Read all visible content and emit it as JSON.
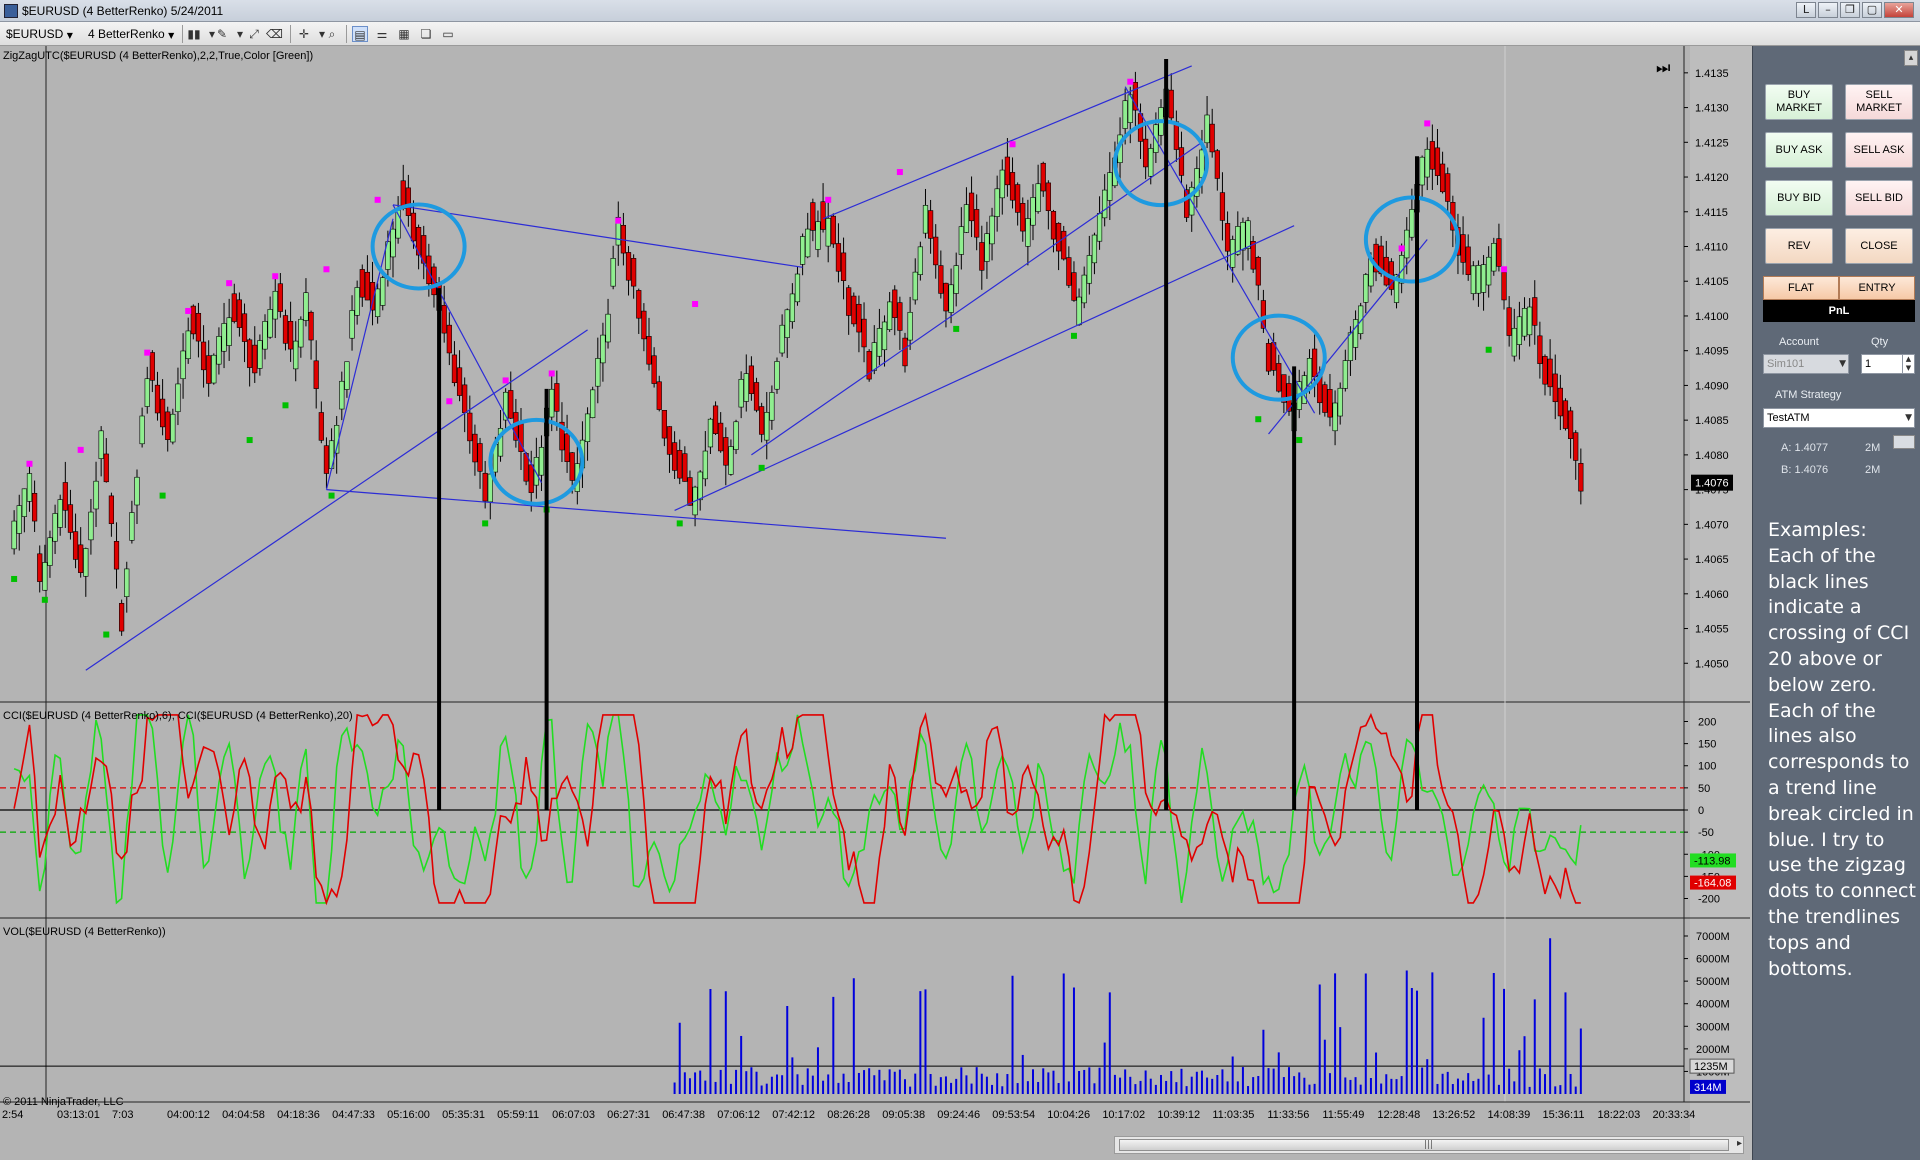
{
  "window": {
    "title": "$EURUSD (4 BetterRenko)  5/24/2011",
    "controls": [
      "L",
      "–",
      "❐",
      "▢",
      "✕"
    ]
  },
  "toolbar": {
    "instrument": "$EURUSD",
    "period": "4 BetterRenko"
  },
  "chart_data": [
    {
      "type": "candlestick",
      "panel_label": "ZigZagUTC($EURUSD (4 BetterRenko),2,2,True,Color [Green])",
      "y_ticks": [
        "1.4135",
        "1.4130",
        "1.4125",
        "1.4120",
        "1.4115",
        "1.4110",
        "1.4105",
        "1.4100",
        "1.4095",
        "1.4090",
        "1.4085",
        "1.4080",
        "1.4075",
        "1.4070",
        "1.4065",
        "1.4060",
        "1.4055",
        "1.4050"
      ],
      "ylim": [
        1.4045,
        1.4138
      ],
      "last_price": "1.4076",
      "up_color": "#90ee90",
      "down_color": "#e00000",
      "zigzag_dot_high_color": "#ff00ff",
      "zigzag_dot_low_color": "#00c000",
      "price_path": [
        {
          "b": 0,
          "v": 1.4067
        },
        {
          "b": 4,
          "v": 1.4078
        },
        {
          "b": 6,
          "v": 1.4061
        },
        {
          "b": 10,
          "v": 1.4075
        },
        {
          "b": 14,
          "v": 1.4062
        },
        {
          "b": 18,
          "v": 1.4082
        },
        {
          "b": 22,
          "v": 1.4056
        },
        {
          "b": 27,
          "v": 1.4092
        },
        {
          "b": 31,
          "v": 1.4082
        },
        {
          "b": 35,
          "v": 1.4099
        },
        {
          "b": 39,
          "v": 1.4091
        },
        {
          "b": 43,
          "v": 1.4101
        },
        {
          "b": 48,
          "v": 1.4092
        },
        {
          "b": 52,
          "v": 1.4104
        },
        {
          "b": 55,
          "v": 1.4094
        },
        {
          "b": 58,
          "v": 1.4103
        },
        {
          "b": 62,
          "v": 1.4076
        },
        {
          "b": 68,
          "v": 1.4104
        },
        {
          "b": 71,
          "v": 1.4101
        },
        {
          "b": 76,
          "v": 1.4116
        },
        {
          "b": 80,
          "v": 1.411
        },
        {
          "b": 84,
          "v": 1.41
        },
        {
          "b": 90,
          "v": 1.4083
        },
        {
          "b": 93,
          "v": 1.4073
        },
        {
          "b": 97,
          "v": 1.4088
        },
        {
          "b": 102,
          "v": 1.4075
        },
        {
          "b": 106,
          "v": 1.4089
        },
        {
          "b": 110,
          "v": 1.4075
        },
        {
          "b": 116,
          "v": 1.4096
        },
        {
          "b": 119,
          "v": 1.4113
        },
        {
          "b": 124,
          "v": 1.4096
        },
        {
          "b": 128,
          "v": 1.4083
        },
        {
          "b": 133,
          "v": 1.4073
        },
        {
          "b": 137,
          "v": 1.4085
        },
        {
          "b": 140,
          "v": 1.4079
        },
        {
          "b": 144,
          "v": 1.4093
        },
        {
          "b": 147,
          "v": 1.4083
        },
        {
          "b": 152,
          "v": 1.4101
        },
        {
          "b": 156,
          "v": 1.4113
        },
        {
          "b": 160,
          "v": 1.4114
        },
        {
          "b": 164,
          "v": 1.4101
        },
        {
          "b": 168,
          "v": 1.4092
        },
        {
          "b": 172,
          "v": 1.4103
        },
        {
          "b": 175,
          "v": 1.4094
        },
        {
          "b": 179,
          "v": 1.4116
        },
        {
          "b": 183,
          "v": 1.41
        },
        {
          "b": 187,
          "v": 1.4116
        },
        {
          "b": 190,
          "v": 1.4108
        },
        {
          "b": 194,
          "v": 1.412
        },
        {
          "b": 198,
          "v": 1.4112
        },
        {
          "b": 201,
          "v": 1.4119
        },
        {
          "b": 205,
          "v": 1.411
        },
        {
          "b": 208,
          "v": 1.4101
        },
        {
          "b": 212,
          "v": 1.4113
        },
        {
          "b": 216,
          "v": 1.4123
        },
        {
          "b": 219,
          "v": 1.4133
        },
        {
          "b": 222,
          "v": 1.412
        },
        {
          "b": 226,
          "v": 1.4133
        },
        {
          "b": 230,
          "v": 1.4115
        },
        {
          "b": 234,
          "v": 1.4128
        },
        {
          "b": 238,
          "v": 1.411
        },
        {
          "b": 242,
          "v": 1.4113
        },
        {
          "b": 246,
          "v": 1.4093
        },
        {
          "b": 250,
          "v": 1.4087
        },
        {
          "b": 254,
          "v": 1.4094
        },
        {
          "b": 258,
          "v": 1.4084
        },
        {
          "b": 262,
          "v": 1.4097
        },
        {
          "b": 266,
          "v": 1.4108
        },
        {
          "b": 270,
          "v": 1.4104
        },
        {
          "b": 274,
          "v": 1.4116
        },
        {
          "b": 277,
          "v": 1.4125
        },
        {
          "b": 281,
          "v": 1.4115
        },
        {
          "b": 285,
          "v": 1.4105
        },
        {
          "b": 290,
          "v": 1.411
        },
        {
          "b": 293,
          "v": 1.4098
        },
        {
          "b": 297,
          "v": 1.4102
        },
        {
          "b": 300,
          "v": 1.409
        },
        {
          "b": 304,
          "v": 1.4084
        },
        {
          "b": 307,
          "v": 1.4076
        }
      ],
      "zigzag_highs": [
        {
          "b": 4,
          "v": 1.4078
        },
        {
          "b": 14,
          "v": 1.408
        },
        {
          "b": 27,
          "v": 1.4094
        },
        {
          "b": 35,
          "v": 1.41
        },
        {
          "b": 43,
          "v": 1.4104
        },
        {
          "b": 52,
          "v": 1.4105
        },
        {
          "b": 62,
          "v": 1.4106
        },
        {
          "b": 72,
          "v": 1.4116
        },
        {
          "b": 86,
          "v": 1.4087
        },
        {
          "b": 97,
          "v": 1.409
        },
        {
          "b": 106,
          "v": 1.4091
        },
        {
          "b": 119,
          "v": 1.4113
        },
        {
          "b": 134,
          "v": 1.4101
        },
        {
          "b": 160,
          "v": 1.4116
        },
        {
          "b": 174,
          "v": 1.412
        },
        {
          "b": 196,
          "v": 1.4124
        },
        {
          "b": 219,
          "v": 1.4133
        },
        {
          "b": 272,
          "v": 1.4109
        },
        {
          "b": 277,
          "v": 1.4127
        },
        {
          "b": 292,
          "v": 1.4106
        }
      ],
      "zigzag_lows": [
        {
          "b": 1,
          "v": 1.4063
        },
        {
          "b": 7,
          "v": 1.406
        },
        {
          "b": 19,
          "v": 1.4055
        },
        {
          "b": 30,
          "v": 1.4075
        },
        {
          "b": 47,
          "v": 1.4083
        },
        {
          "b": 54,
          "v": 1.4088
        },
        {
          "b": 63,
          "v": 1.4075
        },
        {
          "b": 93,
          "v": 1.4071
        },
        {
          "b": 105,
          "v": 1.4073
        },
        {
          "b": 131,
          "v": 1.4071
        },
        {
          "b": 147,
          "v": 1.4079
        },
        {
          "b": 185,
          "v": 1.4099
        },
        {
          "b": 208,
          "v": 1.4098
        },
        {
          "b": 244,
          "v": 1.4086
        },
        {
          "b": 252,
          "v": 1.4083
        },
        {
          "b": 289,
          "v": 1.4096
        }
      ],
      "trendlines": [
        {
          "from": {
            "b": 15,
            "v": 1.4049
          },
          "to": {
            "b": 113,
            "v": 1.4098
          }
        },
        {
          "from": {
            "b": 62,
            "v": 1.4075
          },
          "to": {
            "b": 183,
            "v": 1.4068
          }
        },
        {
          "from": {
            "b": 62,
            "v": 1.4075
          },
          "to": {
            "b": 75,
            "v": 1.4114
          }
        },
        {
          "from": {
            "b": 75,
            "v": 1.4116
          },
          "to": {
            "b": 155,
            "v": 1.4107
          }
        },
        {
          "from": {
            "b": 75,
            "v": 1.4116
          },
          "to": {
            "b": 104,
            "v": 1.4076
          }
        },
        {
          "from": {
            "b": 130,
            "v": 1.4072
          },
          "to": {
            "b": 251,
            "v": 1.4113
          }
        },
        {
          "from": {
            "b": 145,
            "v": 1.408
          },
          "to": {
            "b": 233,
            "v": 1.4125
          }
        },
        {
          "from": {
            "b": 159,
            "v": 1.4114
          },
          "to": {
            "b": 231,
            "v": 1.4136
          }
        },
        {
          "from": {
            "b": 218,
            "v": 1.4133
          },
          "to": {
            "b": 255,
            "v": 1.4086
          }
        },
        {
          "from": {
            "b": 246,
            "v": 1.4083
          },
          "to": {
            "b": 277,
            "v": 1.4111
          }
        }
      ],
      "circles": [
        {
          "b": 80,
          "v": 1.411
        },
        {
          "b": 103,
          "v": 1.4079
        },
        {
          "b": 225,
          "v": 1.4122
        },
        {
          "b": 248,
          "v": 1.4094
        },
        {
          "b": 274,
          "v": 1.4111
        }
      ],
      "signal_lines_bars": [
        84,
        105,
        226,
        251,
        275
      ]
    },
    {
      "type": "line",
      "panel_label": "CCI($EURUSD (4 BetterRenko),6), CCI($EURUSD (4 BetterRenko),20)",
      "y_ticks": [
        "200",
        "150",
        "100",
        "50",
        "0",
        "-50",
        "-100",
        "-150",
        "-200"
      ],
      "ylim": [
        -235,
        235
      ],
      "reference_lines": [
        {
          "v": 50,
          "color": "#e00000"
        },
        {
          "v": -50,
          "color": "#00aa00"
        },
        {
          "v": 0,
          "color": "#000000"
        }
      ],
      "last_values": {
        "cci6": "-113.98",
        "cci20": "-164.08"
      },
      "series": [
        {
          "name": "CCI 6",
          "color": "#22dd22"
        },
        {
          "name": "CCI 20",
          "color": "#e00000"
        }
      ]
    },
    {
      "type": "bar",
      "panel_label": "VOL($EURUSD (4 BetterRenko))",
      "y_ticks": [
        "7000M",
        "6000M",
        "5000M",
        "4000M",
        "3000M",
        "2000M",
        "1000M"
      ],
      "ylim": [
        0,
        7000
      ],
      "marker_line": "1235M",
      "last_value": "314M",
      "color": "#0000dd"
    }
  ],
  "time_axis": [
    "2:54",
    "03:13:01",
    "7:03",
    "04:00:12",
    "04:04:58",
    "04:18:36",
    "04:47:33",
    "05:16:00",
    "05:35:31",
    "05:59:11",
    "06:07:03",
    "06:27:31",
    "06:47:38",
    "07:06:12",
    "07:42:12",
    "08:26:28",
    "09:05:38",
    "09:24:46",
    "09:53:54",
    "10:04:26",
    "10:17:02",
    "10:39:12",
    "11:03:35",
    "11:33:56",
    "11:55:49",
    "12:28:48",
    "13:26:52",
    "14:08:39",
    "15:36:11",
    "18:22:03",
    "20:33:34"
  ],
  "copyright": "© 2011 NinjaTrader, LLC",
  "trade_panel": {
    "buttons": {
      "buy_market": "BUY MARKET",
      "sell_market": "SELL MARKET",
      "buy_ask": "BUY ASK",
      "sell_ask": "SELL ASK",
      "buy_bid": "BUY BID",
      "sell_bid": "SELL BID",
      "rev": "REV",
      "close": "CLOSE",
      "flat": "FLAT",
      "entry": "ENTRY"
    },
    "pnl_label": "PnL",
    "account_label": "Account",
    "qty_label": "Qty",
    "account_value": "Sim101",
    "qty_value": "1",
    "atm_label": "ATM Strategy",
    "atm_value": "TestATM",
    "a_label": "A: 1.4077",
    "a_val": "2M",
    "b_label": "B: 1.4076",
    "b_val": "2M"
  },
  "note": "Examples:\nEach of the black lines indicate a crossing of CCI 20 above or below zero. Each of the lines also corresponds to a trend line break circled in blue. I try to use the zigzag dots to connect the trendlines tops and bottoms."
}
